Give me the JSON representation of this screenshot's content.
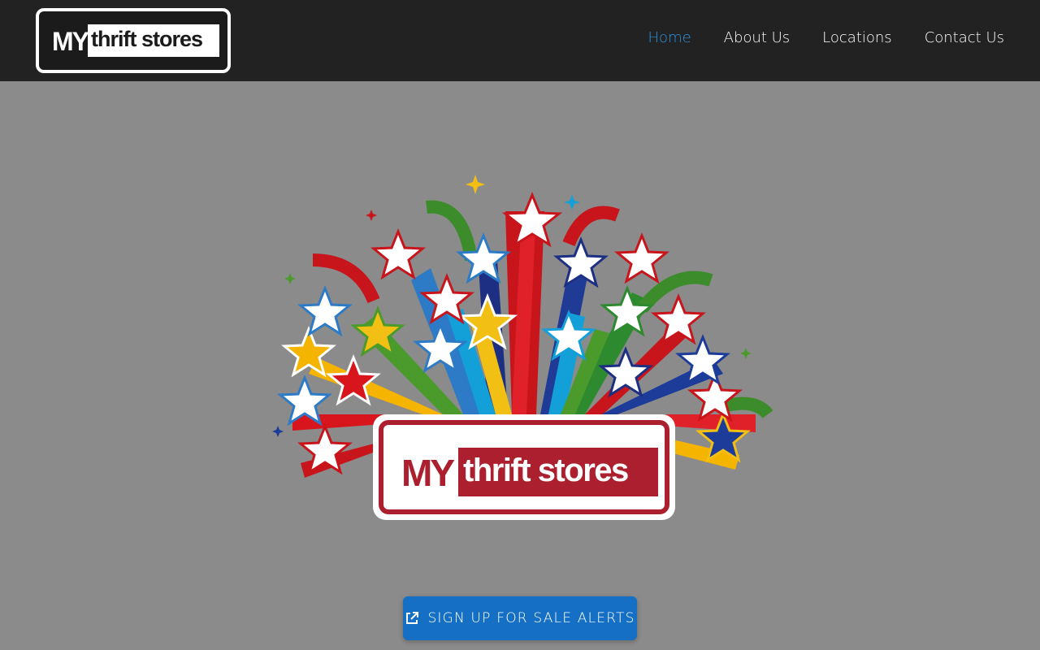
{
  "header": {
    "logo": {
      "my": "MY",
      "thrift": "thrift stores"
    },
    "nav": [
      {
        "label": "Home",
        "active": true
      },
      {
        "label": "About Us",
        "active": false
      },
      {
        "label": "Locations",
        "active": false
      },
      {
        "label": "Contact Us",
        "active": false
      }
    ]
  },
  "hero": {
    "logo": {
      "my": "MY",
      "thrift": "thrift stores"
    },
    "icon": "flag-stars-burst-illustration"
  },
  "cta": {
    "label": "SIGN UP FOR SALE ALERTS",
    "icon": "external-link-icon"
  },
  "colors": {
    "header_bg": "#222222",
    "page_bg": "#8b8b8b",
    "nav_active": "#2a94e0",
    "brand_red": "#ac1f2e",
    "cta_bg": "#1570c5"
  }
}
